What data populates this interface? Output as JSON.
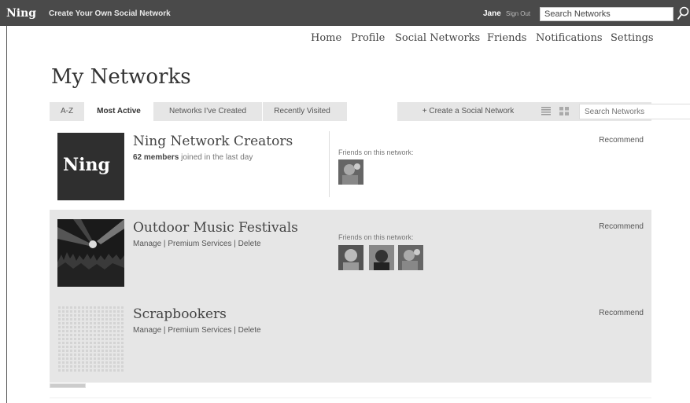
{
  "topbar": {
    "logo": "Ning",
    "tagline": "Create Your Own Social Network",
    "user": "Jane",
    "sign_out": "Sign Out",
    "search_value": "Search Networks"
  },
  "nav": {
    "home": "Home",
    "profile": "Profile",
    "social_networks": "Social Networks",
    "friends": "Friends",
    "notifications": "Notifications",
    "settings": "Settings"
  },
  "page_title": "My Networks",
  "tabs": {
    "az": "A-Z",
    "most_active": "Most Active",
    "created": "Networks I've Created",
    "recent": "Recently Visited",
    "create": "+ Create a Social Network",
    "search_placeholder": "Search Networks"
  },
  "networks": [
    {
      "name": "Ning Network Creators",
      "logo_text": "Ning",
      "members_count": "62 members",
      "members_suffix": "joined in the last day",
      "friends_label": "Friends on this network:",
      "recommend": "Recommend"
    },
    {
      "name": "Outdoor Music Festivals",
      "manage": "Manage",
      "premium": "Premium Services",
      "delete": "Delete",
      "sep": "|",
      "friends_label": "Friends on this network:",
      "recommend": "Recommend"
    },
    {
      "name": "Scrapbookers",
      "manage": "Manage",
      "premium": "Premium Services",
      "delete": "Delete",
      "sep": "|",
      "recommend": "Recommend"
    }
  ],
  "colors": {
    "topbar": "#4a4a4a",
    "tabbar": "#e6e6e6",
    "row_alt": "#e6e6e6"
  }
}
